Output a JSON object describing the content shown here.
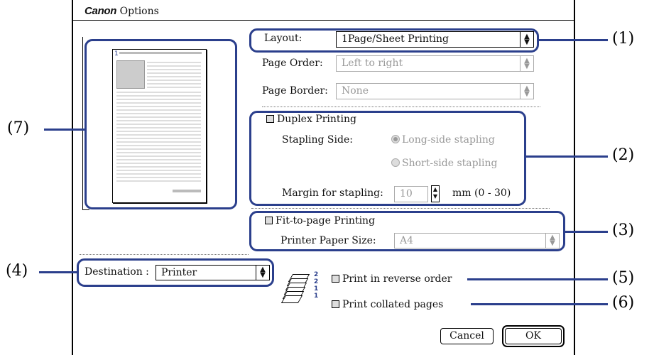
{
  "window": {
    "brand": "Canon",
    "title": "Options"
  },
  "layout": {
    "label": "Layout:",
    "value": "1Page/Sheet Printing"
  },
  "page_order": {
    "label": "Page Order:",
    "value": "Left to right"
  },
  "page_border": {
    "label": "Page Border:",
    "value": "None"
  },
  "duplex": {
    "label": "Duplex Printing",
    "stapling_side_label": "Stapling Side:",
    "long_side": "Long-side stapling",
    "short_side": "Short-side stapling",
    "margin_label": "Margin for stapling:",
    "margin_value": "10",
    "margin_unit": "mm (0 - 30)"
  },
  "fit": {
    "label": "Fit-to-page Printing",
    "paper_label": "Printer Paper Size:",
    "paper_value": "A4"
  },
  "destination": {
    "label": "Destination :",
    "value": "Printer"
  },
  "reverse": {
    "label": "Print in reverse order"
  },
  "collated": {
    "label": "Print collated pages"
  },
  "buttons": {
    "cancel": "Cancel",
    "ok": "OK"
  },
  "preview": {
    "page_number": "1",
    "stack_digits": "2\n2\n1\n1"
  },
  "callouts": {
    "c1": "(1)",
    "c2": "(2)",
    "c3": "(3)",
    "c4": "(4)",
    "c5": "(5)",
    "c6": "(6)",
    "c7": "(7)"
  },
  "colors": {
    "callout": "#2b3f8c"
  }
}
